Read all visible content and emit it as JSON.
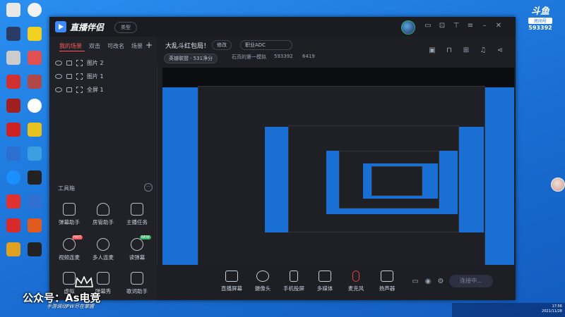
{
  "app": {
    "name": "直播伴侣",
    "type_button": "类型"
  },
  "scene_tabs": [
    "我的场景",
    "双击",
    "可改名",
    "场景"
  ],
  "sources": [
    {
      "label": "图片 2"
    },
    {
      "label": "图片 1"
    },
    {
      "label": "全屏 1"
    }
  ],
  "toolbox": {
    "title": "工具箱",
    "tools": [
      {
        "label": "弹幕助手"
      },
      {
        "label": "房管助手"
      },
      {
        "label": "主播任务"
      },
      {
        "label": "视频连麦",
        "tag": "HOT"
      },
      {
        "label": "多人连麦"
      },
      {
        "label": "读弹幕",
        "tag": "NEW"
      },
      {
        "label": "虚拟"
      },
      {
        "label": "弹幕秀"
      },
      {
        "label": "歌词助手"
      }
    ]
  },
  "stream": {
    "title": "大乱斗红包局！",
    "category_chip": "修改",
    "role_chip": "职业ADC",
    "rank": "英雄联盟 · 531净分",
    "subtitle": "石页的第一模拟",
    "room_id": "593392",
    "heat": "6419"
  },
  "bottom_bar": [
    {
      "label": "直播屏幕",
      "icon": "monitor-icon"
    },
    {
      "label": "摄像头",
      "icon": "camera-icon"
    },
    {
      "label": "手机投屏",
      "icon": "phone-cast-icon"
    },
    {
      "label": "多媒体",
      "icon": "media-icon"
    },
    {
      "label": "麦克风",
      "icon": "microphone-icon"
    },
    {
      "label": "扬声器",
      "icon": "speaker-icon"
    }
  ],
  "connect_button": "连接中...",
  "douyu": {
    "logo": "斗鱼",
    "sub": "房间号",
    "room": "593392"
  },
  "watermark": {
    "text": "公众号：As电竞",
    "sub": "手游调动PW尽在掌握"
  },
  "taskbar": {
    "time": "17:56",
    "date": "2021/11/28"
  },
  "colors": {
    "accent": "#3d8bff",
    "active_tab": "#ff5a5a",
    "desktop": "#1a6fd4"
  }
}
